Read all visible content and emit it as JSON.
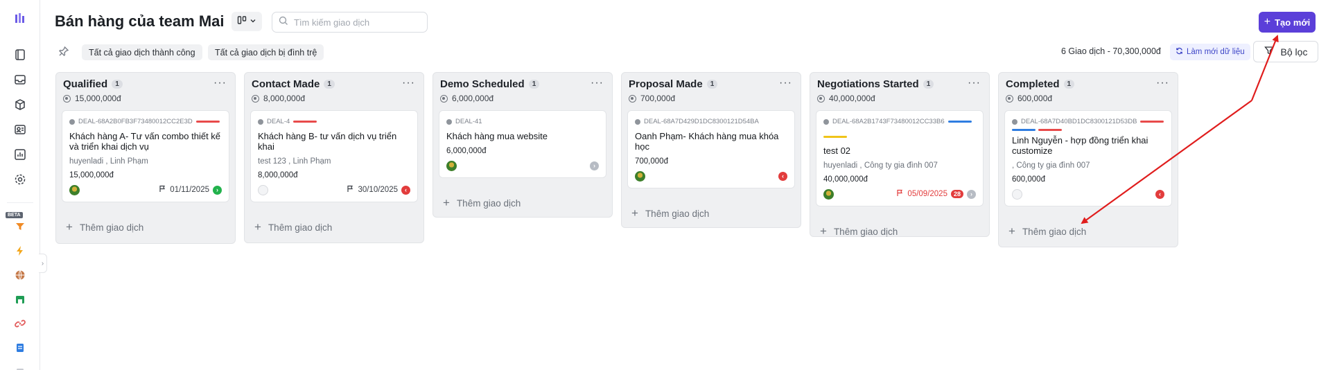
{
  "header": {
    "title": "Bán hàng của team Mai",
    "search_placeholder": "Tìm kiếm giao dịch",
    "new_button": "Tạo mới"
  },
  "filters": {
    "chips": [
      "Tất cả giao dịch thành công",
      "Tất cả giao dịch bị đình trệ"
    ],
    "summary": "6 Giao dịch - 70,300,000đ",
    "refresh_label": "Làm mới dữ liệu",
    "filter_button": "Bộ lọc"
  },
  "sidebar": {
    "beta_label": "BETA",
    "icons": [
      "book-icon",
      "inbox-icon",
      "box-icon",
      "contacts-icon",
      "chart-icon",
      "settings-icon",
      "funnel-icon",
      "lightning-icon",
      "globe-icon",
      "store-icon",
      "link-icon",
      "document-icon"
    ]
  },
  "add_deal_label": "Thêm giao dịch",
  "columns": [
    {
      "name": "Qualified",
      "count": "1",
      "amount": "15,000,000đ",
      "cards": [
        {
          "id": "DEAL-68A2B0FB3F73480012CC2E3D",
          "title": "Khách hàng A- Tư vấn combo thiết kế và triển khai dịch vụ",
          "meta": "huyenladi , Linh Phạm",
          "value": "15,000,000đ",
          "date": "01/11/2025",
          "status": "green"
        }
      ]
    },
    {
      "name": "Contact Made",
      "count": "1",
      "amount": "8,000,000đ",
      "cards": [
        {
          "id": "DEAL-4",
          "title": "Khách hàng B- tư vấn dịch vụ triển khai",
          "meta": "test 123 , Linh Phạm",
          "value": "8,000,000đ",
          "date": "30/10/2025",
          "status": "red"
        }
      ]
    },
    {
      "name": "Demo Scheduled",
      "count": "1",
      "amount": "6,000,000đ",
      "cards": [
        {
          "id": "DEAL-41",
          "title": "Khách hàng mua website",
          "meta": "",
          "value": "6,000,000đ",
          "date": "",
          "status": "grey"
        }
      ]
    },
    {
      "name": "Proposal Made",
      "count": "1",
      "amount": "700,000đ",
      "cards": [
        {
          "id": "DEAL-68A7D429D1DC8300121D54BA",
          "title": "Oanh Phạm- Khách hàng mua khóa học",
          "meta": "",
          "value": "700,000đ",
          "date": "",
          "status": "red"
        }
      ]
    },
    {
      "name": "Negotiations Started",
      "count": "1",
      "amount": "40,000,000đ",
      "cards": [
        {
          "id": "DEAL-68A2B1743F73480012CC33B6",
          "title": "test 02",
          "meta": "huyenladi , Công ty gia đình 007",
          "value": "40,000,000đ",
          "date": "05/09/2025",
          "badge": "28",
          "status": "grey"
        }
      ]
    },
    {
      "name": "Completed",
      "count": "1",
      "amount": "600,000đ",
      "cards": [
        {
          "id": "DEAL-68A7D40BD1DC8300121D53DB",
          "title": "Linh Nguyễn - hợp đồng triển khai customize",
          "meta": ", Công ty gia đình 007",
          "value": "600,000đ",
          "date": "",
          "status": "red"
        }
      ]
    }
  ],
  "colors": {
    "accent": "#5b3fd9",
    "tag_red": "#e84a4a",
    "tag_blue": "#2f7de1",
    "tag_yellow": "#f0c419",
    "annotation_arrow": "#e01d1d"
  }
}
